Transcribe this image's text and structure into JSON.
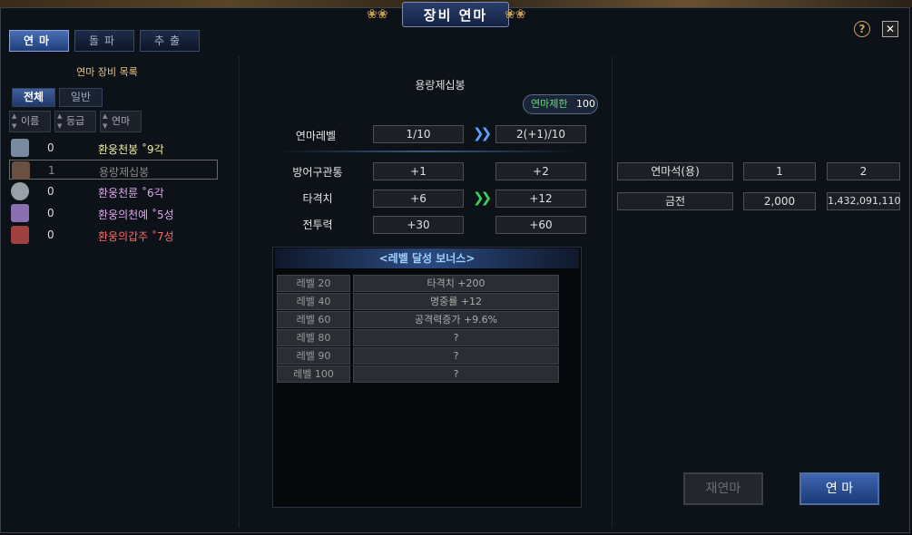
{
  "window": {
    "title": "장비 연마"
  },
  "header": {
    "help_label": "?",
    "close_label": "✕"
  },
  "tabs": [
    {
      "label": "연마",
      "active": true
    },
    {
      "label": "돌파",
      "active": false
    },
    {
      "label": "추출",
      "active": false
    }
  ],
  "list": {
    "header": "연마 장비 목록",
    "filters": [
      {
        "label": "전체",
        "active": true
      },
      {
        "label": "일반",
        "active": false
      }
    ],
    "sort": [
      {
        "label": "이름"
      },
      {
        "label": "등급"
      },
      {
        "label": "연마"
      }
    ],
    "items": [
      {
        "count": "0",
        "name": "환웅천봉 ˚9각",
        "color": "#f0f0a0",
        "icon": "spear-icon",
        "icon_color": "#7a8aa0"
      },
      {
        "count": "1",
        "name": "용랑제십봉",
        "color": "#8a8a8a",
        "icon": "staff-icon",
        "icon_color": "#6a5040",
        "selected": true
      },
      {
        "count": "0",
        "name": "환웅천륜 ˚6각",
        "color": "#e0a8f0",
        "icon": "ring-icon",
        "icon_color": "#9aa0a8"
      },
      {
        "count": "0",
        "name": "환웅의천예 ˚5성",
        "color": "#e0a8f0",
        "icon": "armor-icon",
        "icon_color": "#8a70b0"
      },
      {
        "count": "0",
        "name": "환웅의갑주 ˚7성",
        "color": "#ff6a6a",
        "icon": "armor-red-icon",
        "icon_color": "#a04040"
      }
    ]
  },
  "main": {
    "item_name": "용랑제십봉",
    "limit_label": "연마제한",
    "limit_value": "100",
    "level": {
      "label": "연마레벨",
      "current": "1/10",
      "next": "2(+1)/10"
    },
    "stats": [
      {
        "label": "방어구관통",
        "current": "+1",
        "next": "+2"
      },
      {
        "label": "타격치",
        "current": "+6",
        "next": "+12"
      },
      {
        "label": "전투력",
        "current": "+30",
        "next": "+60"
      }
    ],
    "bonus_title": "<레벨 달성 보너스>",
    "bonus": [
      {
        "level": "레벨 20",
        "value": "타격치 +200"
      },
      {
        "level": "레벨 40",
        "value": "명중률 +12"
      },
      {
        "level": "레벨 60",
        "value": "공격력증가 +9.6%"
      },
      {
        "level": "레벨 80",
        "value": "?"
      },
      {
        "level": "레벨 90",
        "value": "?"
      },
      {
        "level": "레벨 100",
        "value": "?"
      }
    ]
  },
  "cost": [
    {
      "name": "연마석(용)",
      "need": "1",
      "have": "2"
    },
    {
      "name": "금전",
      "need": "2,000",
      "have": "1,432,091,110"
    }
  ],
  "buttons": {
    "redo": "재연마",
    "refine": "연 마"
  },
  "colors": {
    "accent": "#3e65b0",
    "arrow": "#5aa0ff",
    "arrow_green": "#3ad05a"
  }
}
